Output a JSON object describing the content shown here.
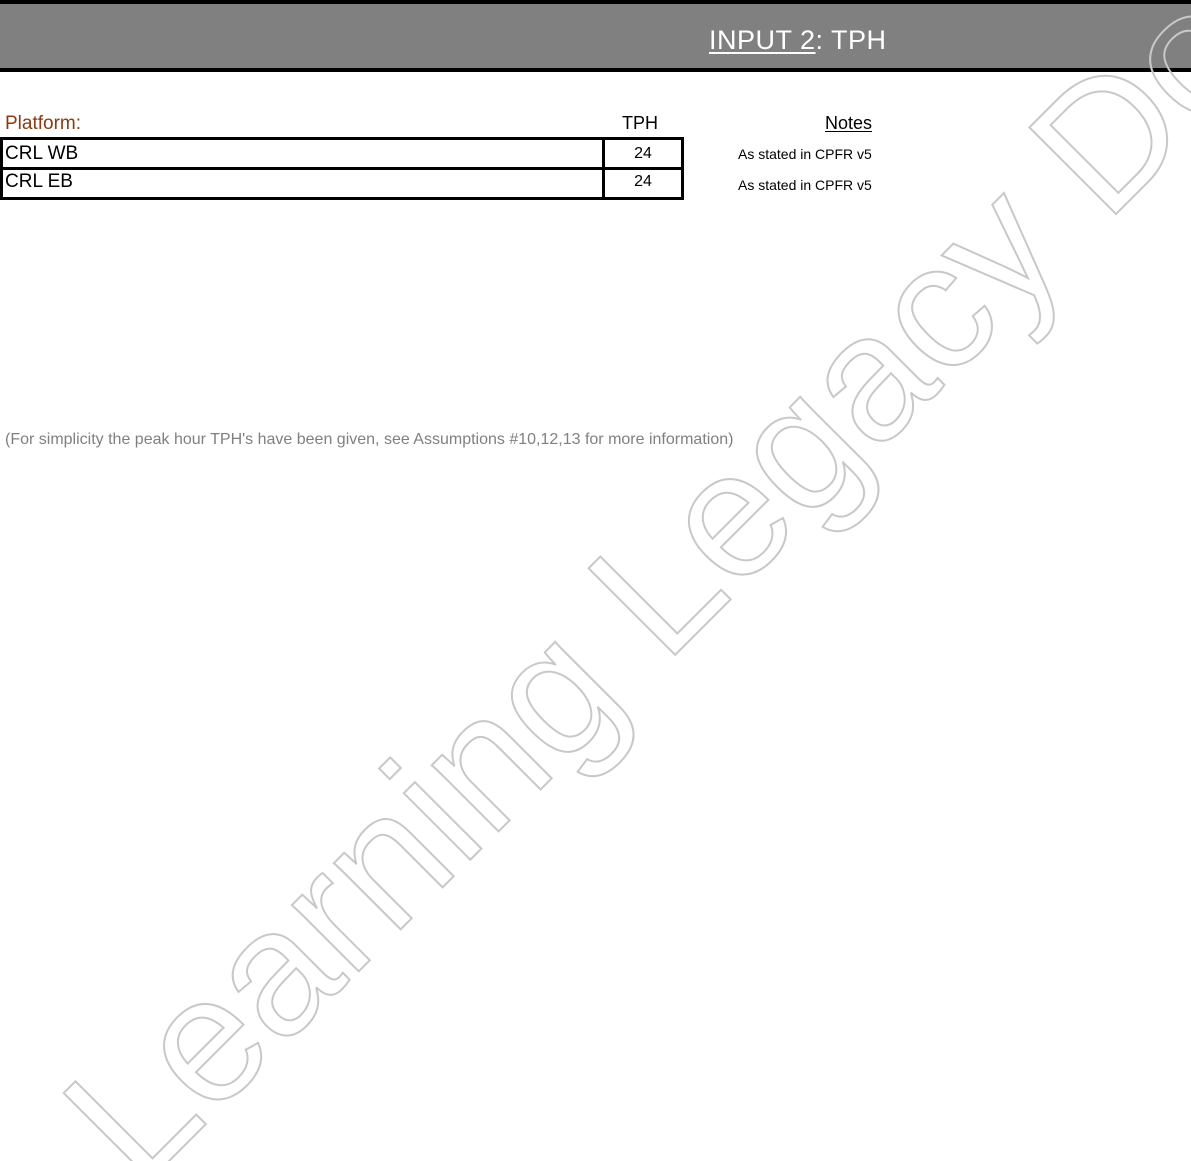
{
  "header": {
    "title_underlined": "INPUT 2",
    "title_rest": ": TPH"
  },
  "columns": {
    "platform": "Platform:",
    "tph": "TPH",
    "notes": "Notes"
  },
  "rows": [
    {
      "platform": "CRL WB",
      "tph": "24",
      "note": "As stated in CPFR v5"
    },
    {
      "platform": "CRL EB",
      "tph": "24",
      "note": "As stated in CPFR v5"
    }
  ],
  "footnote": "(For simplicity the peak hour TPH's have been given, see Assumptions #10,12,13 for more information)",
  "watermark": "Learning Legacy Document",
  "colors": {
    "header_bg": "#808080",
    "platform_label": "#8b3a0f",
    "footnote": "#808080"
  }
}
